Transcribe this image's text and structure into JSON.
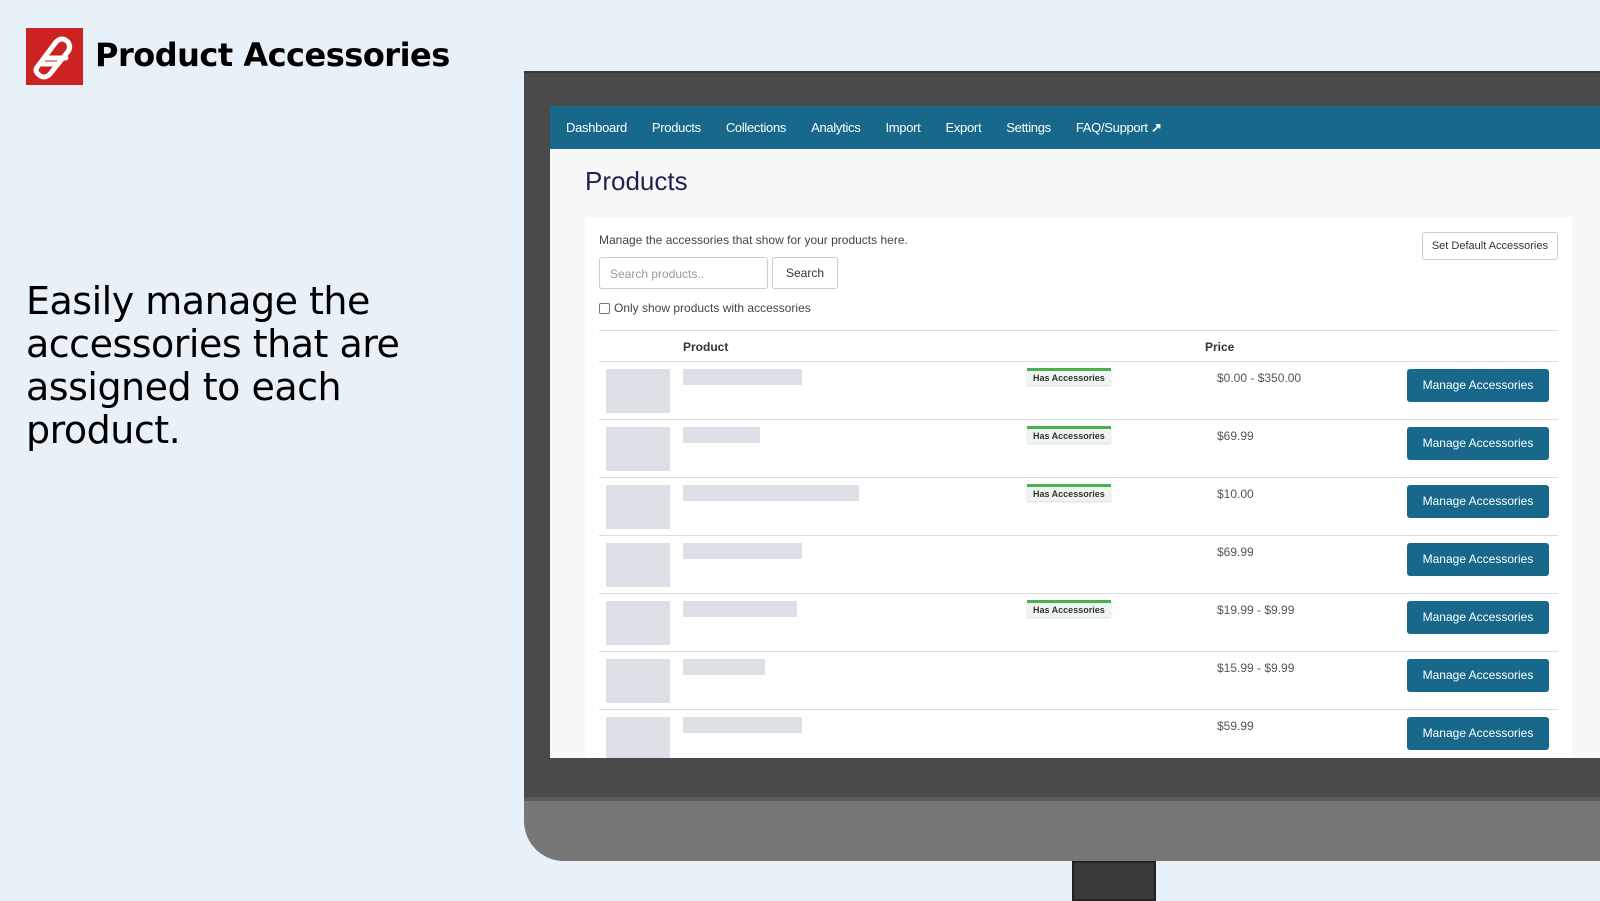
{
  "brand": {
    "title": "Product Accessories",
    "logo_color": "#cc2222"
  },
  "tagline": "Easily manage the accessories that are assigned to each product.",
  "nav": {
    "items": [
      "Dashboard",
      "Products",
      "Collections",
      "Analytics",
      "Import",
      "Export",
      "Settings",
      "FAQ/Support"
    ],
    "external_icon": "external-link-icon",
    "color": "#17688a"
  },
  "page": {
    "title": "Products",
    "description": "Manage the accessories that show for your products here.",
    "set_default_label": "Set Default Accessories"
  },
  "search": {
    "placeholder": "Search products..",
    "button": "Search"
  },
  "filter": {
    "label": "Only show products with accessories",
    "checked": false
  },
  "table": {
    "headers": {
      "product": "Product",
      "price": "Price"
    },
    "badge_label": "Has Accessories",
    "button_label": "Manage Accessories",
    "rows": [
      {
        "has_accessories": true,
        "price": "$0.00 - $350.00"
      },
      {
        "has_accessories": true,
        "price": "$69.99"
      },
      {
        "has_accessories": true,
        "price": "$10.00"
      },
      {
        "has_accessories": false,
        "price": "$69.99"
      },
      {
        "has_accessories": true,
        "price": "$19.99 - $9.99"
      },
      {
        "has_accessories": false,
        "price": "$15.99 - $9.99"
      },
      {
        "has_accessories": false,
        "price": "$59.99"
      }
    ]
  }
}
